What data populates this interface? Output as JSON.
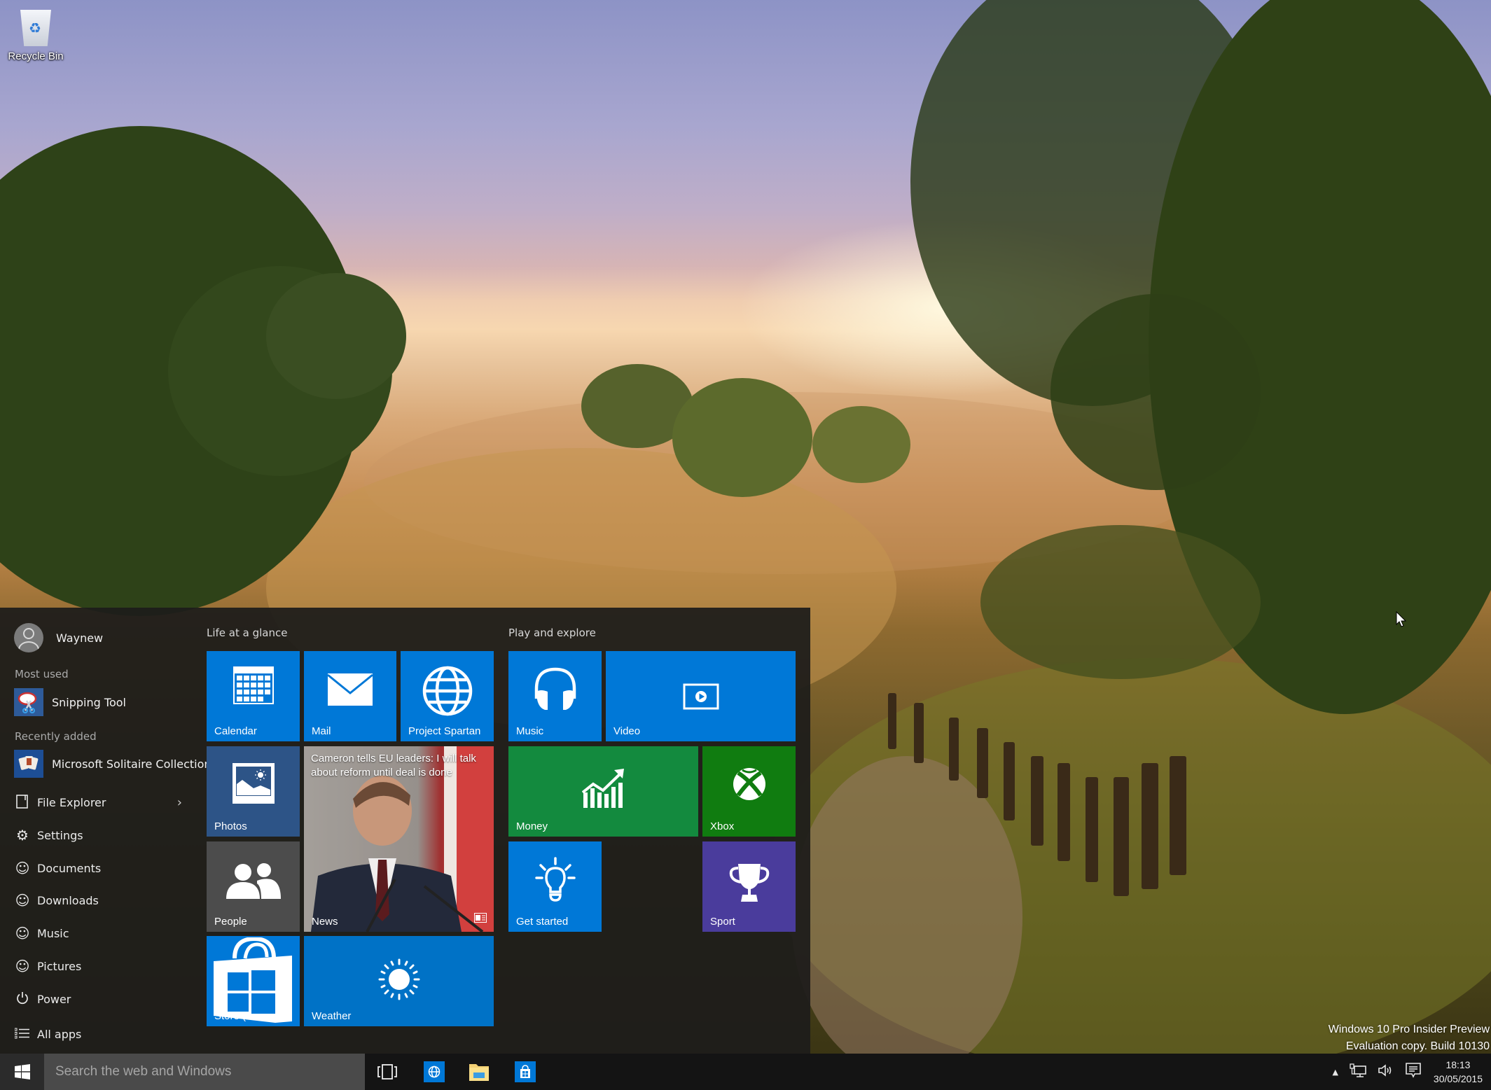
{
  "desktop": {
    "icons": [
      {
        "label": "Recycle Bin",
        "icon": "recycle-bin-icon"
      }
    ],
    "watermark": {
      "line1": "Windows 10 Pro Insider Preview",
      "line2": "Evaluation copy. Build 10130"
    }
  },
  "start_menu": {
    "user": {
      "name": "Waynew",
      "icon": "user-avatar-icon"
    },
    "most_used": {
      "label": "Most used",
      "items": [
        {
          "name": "Snipping Tool",
          "icon": "snipping-tool-icon"
        }
      ]
    },
    "recently_added": {
      "label": "Recently added",
      "items": [
        {
          "name": "Microsoft Solitaire Collection",
          "icon": "solitaire-icon"
        }
      ]
    },
    "places": [
      {
        "label": "File Explorer",
        "icon": "file-explorer-icon",
        "has_submenu": true
      },
      {
        "label": "Settings",
        "icon": "gear-icon"
      },
      {
        "label": "Documents",
        "icon": "smiley-icon"
      },
      {
        "label": "Downloads",
        "icon": "smiley-icon"
      },
      {
        "label": "Music",
        "icon": "smiley-icon"
      },
      {
        "label": "Pictures",
        "icon": "smiley-icon"
      },
      {
        "label": "Power",
        "icon": "power-icon"
      },
      {
        "label": "All apps",
        "icon": "list-icon"
      }
    ],
    "groups": [
      {
        "title": "Life at a glance",
        "tiles": [
          {
            "label": "Calendar",
            "icon": "calendar-icon",
            "color": "#0078d7"
          },
          {
            "label": "Mail",
            "icon": "mail-icon",
            "color": "#0078d7"
          },
          {
            "label": "Project Spartan",
            "icon": "globe-icon",
            "color": "#0078d7"
          },
          {
            "label": "Photos",
            "icon": "photos-icon",
            "color": "#2d5487"
          },
          {
            "label": "News",
            "icon": "news-icon",
            "headline": "Cameron tells EU leaders: I will talk about reform until deal is done"
          },
          {
            "label": "People",
            "icon": "people-icon",
            "color": "#4c4c4c"
          },
          {
            "label": "Store (Beta)",
            "icon": "store-icon",
            "color": "#0078d7"
          },
          {
            "label": "Weather",
            "icon": "sun-icon",
            "color": "#0072c6"
          }
        ]
      },
      {
        "title": "Play and explore",
        "tiles": [
          {
            "label": "Music",
            "icon": "headphones-icon",
            "color": "#0078d7"
          },
          {
            "label": "Video",
            "icon": "video-icon",
            "color": "#0078d7"
          },
          {
            "label": "Money",
            "icon": "chart-icon",
            "color": "#138a3e"
          },
          {
            "label": "Xbox",
            "icon": "xbox-icon",
            "color": "#107c10"
          },
          {
            "label": "Get started",
            "icon": "lightbulb-icon",
            "color": "#0078d7"
          },
          {
            "label": "Sport",
            "icon": "trophy-icon",
            "color": "#4a3c9c"
          }
        ]
      }
    ]
  },
  "taskbar": {
    "search_placeholder": "Search the web and Windows",
    "pinned": [
      {
        "name": "Task View",
        "icon": "task-view-icon"
      },
      {
        "name": "Project Spartan",
        "icon": "spartan-icon"
      },
      {
        "name": "File Explorer",
        "icon": "folder-icon"
      },
      {
        "name": "Store",
        "icon": "store-icon"
      }
    ],
    "tray": {
      "icons": [
        "chevron-up-icon",
        "network-icon",
        "volume-icon",
        "action-center-icon"
      ],
      "time": "18:13",
      "date": "30/05/2015"
    }
  }
}
